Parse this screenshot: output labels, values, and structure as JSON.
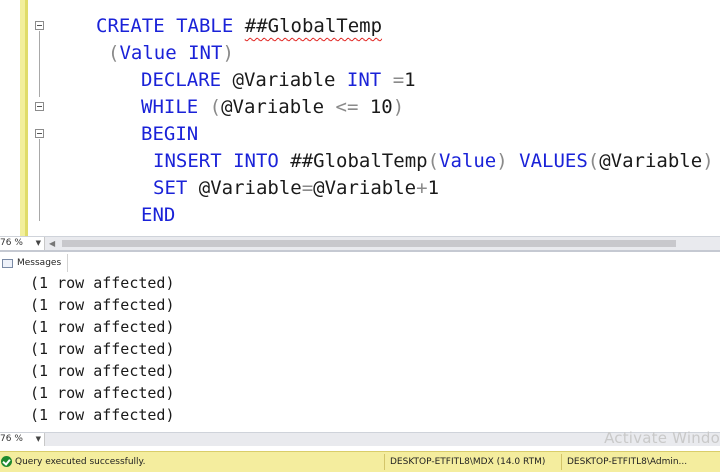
{
  "editor": {
    "lines": [
      {
        "tokens": [
          {
            "t": "CREATE",
            "c": "kw"
          },
          {
            "t": " "
          },
          {
            "t": "TABLE",
            "c": "kw"
          },
          {
            "t": " "
          },
          {
            "t": "##GlobalTemp",
            "c": "sq"
          }
        ]
      },
      {
        "tokens": [
          {
            "t": "(",
            "c": "op"
          },
          {
            "t": "Value",
            "c": "kw"
          },
          {
            "t": " "
          },
          {
            "t": "INT",
            "c": "kw"
          },
          {
            "t": ")",
            "c": "op"
          }
        ]
      },
      {
        "tokens": [
          {
            "t": "DECLARE",
            "c": "kw"
          },
          {
            "t": " @Variable "
          },
          {
            "t": "INT",
            "c": "kw"
          },
          {
            "t": " "
          },
          {
            "t": "=",
            "c": "op"
          },
          {
            "t": "1"
          }
        ]
      },
      {
        "tokens": [
          {
            "t": "WHILE",
            "c": "kw"
          },
          {
            "t": " "
          },
          {
            "t": "(",
            "c": "op"
          },
          {
            "t": "@Variable "
          },
          {
            "t": "<=",
            "c": "op"
          },
          {
            "t": " 10"
          },
          {
            "t": ")",
            "c": "op"
          }
        ]
      },
      {
        "tokens": [
          {
            "t": "BEGIN",
            "c": "kw"
          }
        ]
      },
      {
        "tokens": [
          {
            "t": "INSERT",
            "c": "kw"
          },
          {
            "t": " "
          },
          {
            "t": "INTO",
            "c": "kw"
          },
          {
            "t": " ##GlobalTemp"
          },
          {
            "t": "(",
            "c": "op"
          },
          {
            "t": "Value",
            "c": "kw"
          },
          {
            "t": ")",
            "c": "op"
          },
          {
            "t": " "
          },
          {
            "t": "VALUES",
            "c": "kw"
          },
          {
            "t": "(",
            "c": "op"
          },
          {
            "t": "@Variable"
          },
          {
            "t": ")",
            "c": "op"
          }
        ]
      },
      {
        "tokens": [
          {
            "t": "SET",
            "c": "kw"
          },
          {
            "t": " @Variable"
          },
          {
            "t": "=",
            "c": "op"
          },
          {
            "t": "@Variable"
          },
          {
            "t": "+",
            "c": "op"
          },
          {
            "t": "1"
          }
        ]
      },
      {
        "tokens": [
          {
            "t": "END",
            "c": "kw"
          }
        ]
      }
    ]
  },
  "editor_zoom": "76 %",
  "tabs": {
    "messages": "Messages"
  },
  "messages": [
    "(1 row affected)",
    "(1 row affected)",
    "(1 row affected)",
    "(1 row affected)",
    "(1 row affected)",
    "(1 row affected)",
    "(1 row affected)"
  ],
  "results_zoom": "76 %",
  "watermark": "Activate Windo",
  "status": {
    "message": "Query executed successfully.",
    "server": "DESKTOP-ETFITL8\\MDX (14.0 RTM)",
    "user": "DESKTOP-ETFITL8\\Admin..."
  },
  "colors": {
    "keyword": "#1a22d8",
    "operator": "#8a8a8a",
    "status_bar": "#f4ed9e",
    "success": "#1f8a2e",
    "squiggle": "#e0201c"
  },
  "icons": [
    "fold-collapse-icon",
    "messages-icon",
    "success-check-icon",
    "dropdown-caret-icon",
    "scroll-left-arrow-icon"
  ]
}
